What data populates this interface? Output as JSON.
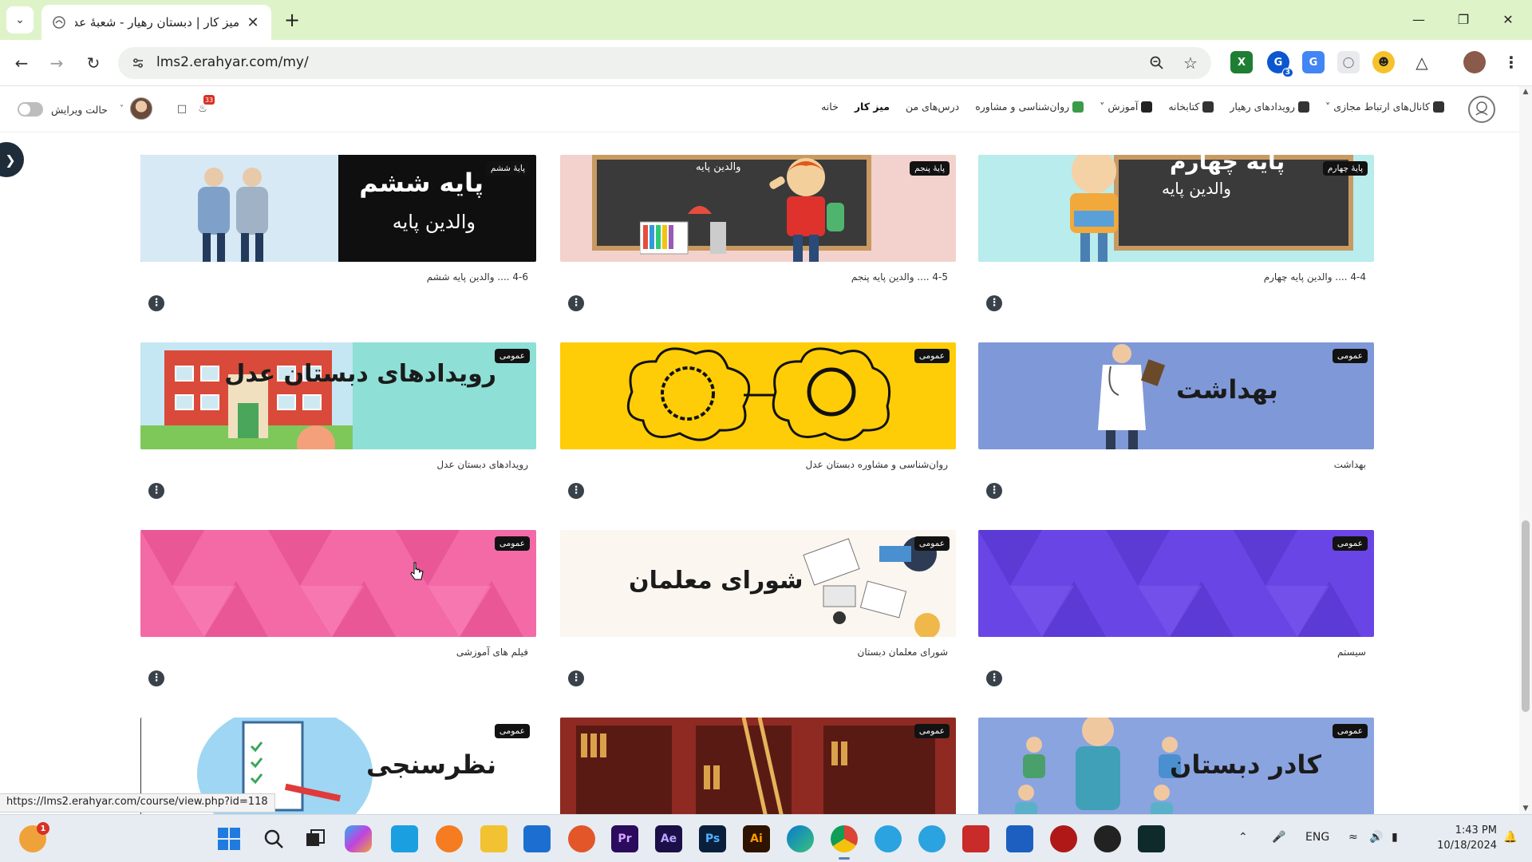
{
  "browser": {
    "tab_title": "میز کار | دبستان رهیار - شعبهٔ عدل",
    "tab_close": "✕",
    "new_tab": "+",
    "url": "lms2.erahyar.com/my/",
    "status_url": "https://lms2.erahyar.com/course/view.php?id=118",
    "extension_badge": "3"
  },
  "site": {
    "nav": [
      {
        "label": "خانه"
      },
      {
        "label": "میز کار"
      },
      {
        "label": "درس‌های من"
      },
      {
        "label": "روان‌شناسی و مشاوره"
      },
      {
        "label": "آموزش"
      },
      {
        "label": "کتابخانه"
      },
      {
        "label": "رویدادهای رهیار"
      },
      {
        "label": "کانال‌های ارتباط مجازی"
      }
    ],
    "edit_mode_label": "حالت ویرایش",
    "notification_count": "33"
  },
  "cards": [
    {
      "badge": "پایهٔ ششم",
      "name": "4-6 .... والدین پایه ششم",
      "title": "پایه ششم",
      "subtitle": "والدین پایه",
      "bg": "#0f0f0f"
    },
    {
      "badge": "پایهٔ پنجم",
      "name": "4-5 .... والدین پایه پنجم",
      "title": "",
      "subtitle": "والدین پایه",
      "bg": "#f3d1cc"
    },
    {
      "badge": "پایهٔ چهارم",
      "name": "4-4 .... والدین پایه چهارم",
      "title": "پایه چهارم",
      "subtitle": "والدین پایه",
      "bg": "#b9ecec"
    },
    {
      "badge": "عمومی",
      "name": "رویدادهای دبستان عدل",
      "title": "رویدادهای دبستان عدل",
      "bg": "#8ee0d6"
    },
    {
      "badge": "عمومی",
      "name": "روان‌شناسی و مشاوره دبستان عدل",
      "title": "",
      "bg": "#ffcd07"
    },
    {
      "badge": "عمومی",
      "name": "بهداشت",
      "title": "بهداشت",
      "bg": "#7f98d8"
    },
    {
      "badge": "عمومی",
      "name": "فیلم های آموزشی",
      "title": "",
      "bg": "#f36aa6"
    },
    {
      "badge": "عمومی",
      "name": "شورای معلمان دبستان",
      "title": "شورای معلمان",
      "bg": "#fbf6ef"
    },
    {
      "badge": "عمومی",
      "name": "سیستم",
      "title": "",
      "bg": "#6a45e6"
    },
    {
      "badge": "عمومی",
      "name": "",
      "title": "نظرسنجی",
      "bg": "#ffffff"
    },
    {
      "badge": "عمومی",
      "name": "",
      "title": "",
      "bg": "#a3322a"
    },
    {
      "badge": "عمومی",
      "name": "",
      "title": "کادر دبستان",
      "bg": "#8aa4e0"
    }
  ],
  "more_label": "⋮",
  "taskbar": {
    "language": "ENG",
    "time": "1:43 PM",
    "date": "10/18/2024",
    "notification_badge": "1",
    "apps": [
      {
        "icon": "weather-icon"
      },
      {
        "icon": "windows-start-icon"
      },
      {
        "icon": "search-icon"
      },
      {
        "icon": "task-view-icon"
      },
      {
        "icon": "copilot-icon"
      },
      {
        "icon": "monitor-icon"
      },
      {
        "icon": "magnifier-app-icon"
      },
      {
        "icon": "file-explorer-icon"
      },
      {
        "icon": "store-icon"
      },
      {
        "icon": "firefox-icon"
      },
      {
        "label": "Pr",
        "icon": "premiere-icon",
        "color": "#2a0b5c"
      },
      {
        "label": "Ae",
        "icon": "after-effects-icon",
        "color": "#1b0f48"
      },
      {
        "label": "Ps",
        "icon": "photoshop-icon",
        "color": "#0a1f3c"
      },
      {
        "label": "Ai",
        "icon": "illustrator-icon",
        "color": "#2e1300"
      },
      {
        "icon": "edge-icon"
      },
      {
        "icon": "chrome-icon"
      },
      {
        "icon": "telegram-icon"
      },
      {
        "icon": "telegram-icon-2"
      },
      {
        "icon": "recorder-icon"
      },
      {
        "icon": "shield-app-icon"
      },
      {
        "icon": "red-app-icon"
      },
      {
        "icon": "w-app-icon"
      },
      {
        "icon": "screen-app-icon"
      }
    ]
  }
}
